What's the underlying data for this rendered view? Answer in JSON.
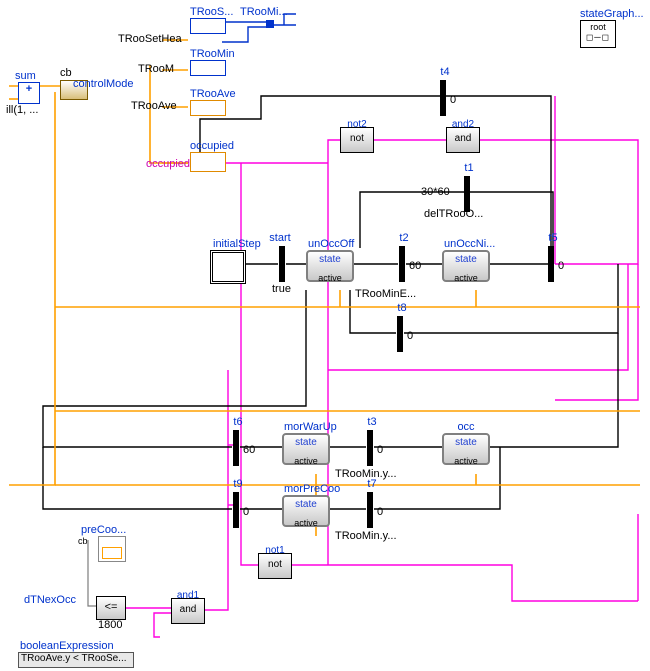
{
  "top": {
    "TRooSetHea": "TRooSetHea",
    "TRooM_left": "TRooM",
    "TRooAve_left": "TRooAve",
    "TRooS": "TRooS...",
    "TRooMi": "TRooMi...",
    "TRooMin": "TRooMin",
    "TRooAve": "TRooAve",
    "occupied": "occupied",
    "occupied2": "occupied",
    "sum": "sum",
    "fill": "ill(1, ...",
    "plus": "+",
    "cb": "cb",
    "controlMode": "controlMode",
    "stateGraph": "stateGraph...",
    "root": "root"
  },
  "gates": {
    "not2": {
      "name": "not2",
      "txt": "not"
    },
    "and2": {
      "name": "and2",
      "txt": "and"
    },
    "not1": {
      "name": "not1",
      "txt": "not"
    },
    "and1": {
      "name": "and1",
      "txt": "and"
    }
  },
  "trans": {
    "t1": {
      "name": "t1",
      "cond": "30*60"
    },
    "t2": {
      "name": "t2",
      "cond": "60"
    },
    "t3": {
      "name": "t3",
      "cond": "0"
    },
    "t4": {
      "name": "t4",
      "cond": "0"
    },
    "t5": {
      "name": "t5",
      "cond": "0"
    },
    "t6": {
      "name": "t6",
      "cond": "60"
    },
    "t7": {
      "name": "t7",
      "cond": "0"
    },
    "t8": {
      "name": "t8",
      "cond": "0"
    },
    "t9": {
      "name": "t9",
      "cond": "0"
    }
  },
  "states": {
    "initialStep": {
      "name": "initialStep"
    },
    "start": {
      "name": "start",
      "cond": "true"
    },
    "unOccOff": {
      "name": "unOccOff",
      "txt": "state",
      "ac": "active"
    },
    "unOccNi": {
      "name": "unOccNi...",
      "txt": "state",
      "ac": "active"
    },
    "morWarUp": {
      "name": "morWarUp",
      "txt": "state",
      "ac": "active"
    },
    "occ": {
      "name": "occ",
      "txt": "state",
      "ac": "active"
    },
    "morPreCoo": {
      "name": "morPreCoo",
      "txt": "state",
      "ac": "active"
    }
  },
  "notes": {
    "delTRooO": "delTRooO...",
    "TRooMinE": "TRooMinE...",
    "TRooMin_y1": "TRooMin.y...",
    "TRooMin_y2": "TRooMin.y..."
  },
  "bottom": {
    "preCoo": "preCoo...",
    "cb": "cb",
    "dTNexOcc": "dTNexOcc",
    "le": "<=",
    "leVal": "1800",
    "booleanExpression": "booleanExpression",
    "expr": "TRooAve.y < TRooSe..."
  }
}
